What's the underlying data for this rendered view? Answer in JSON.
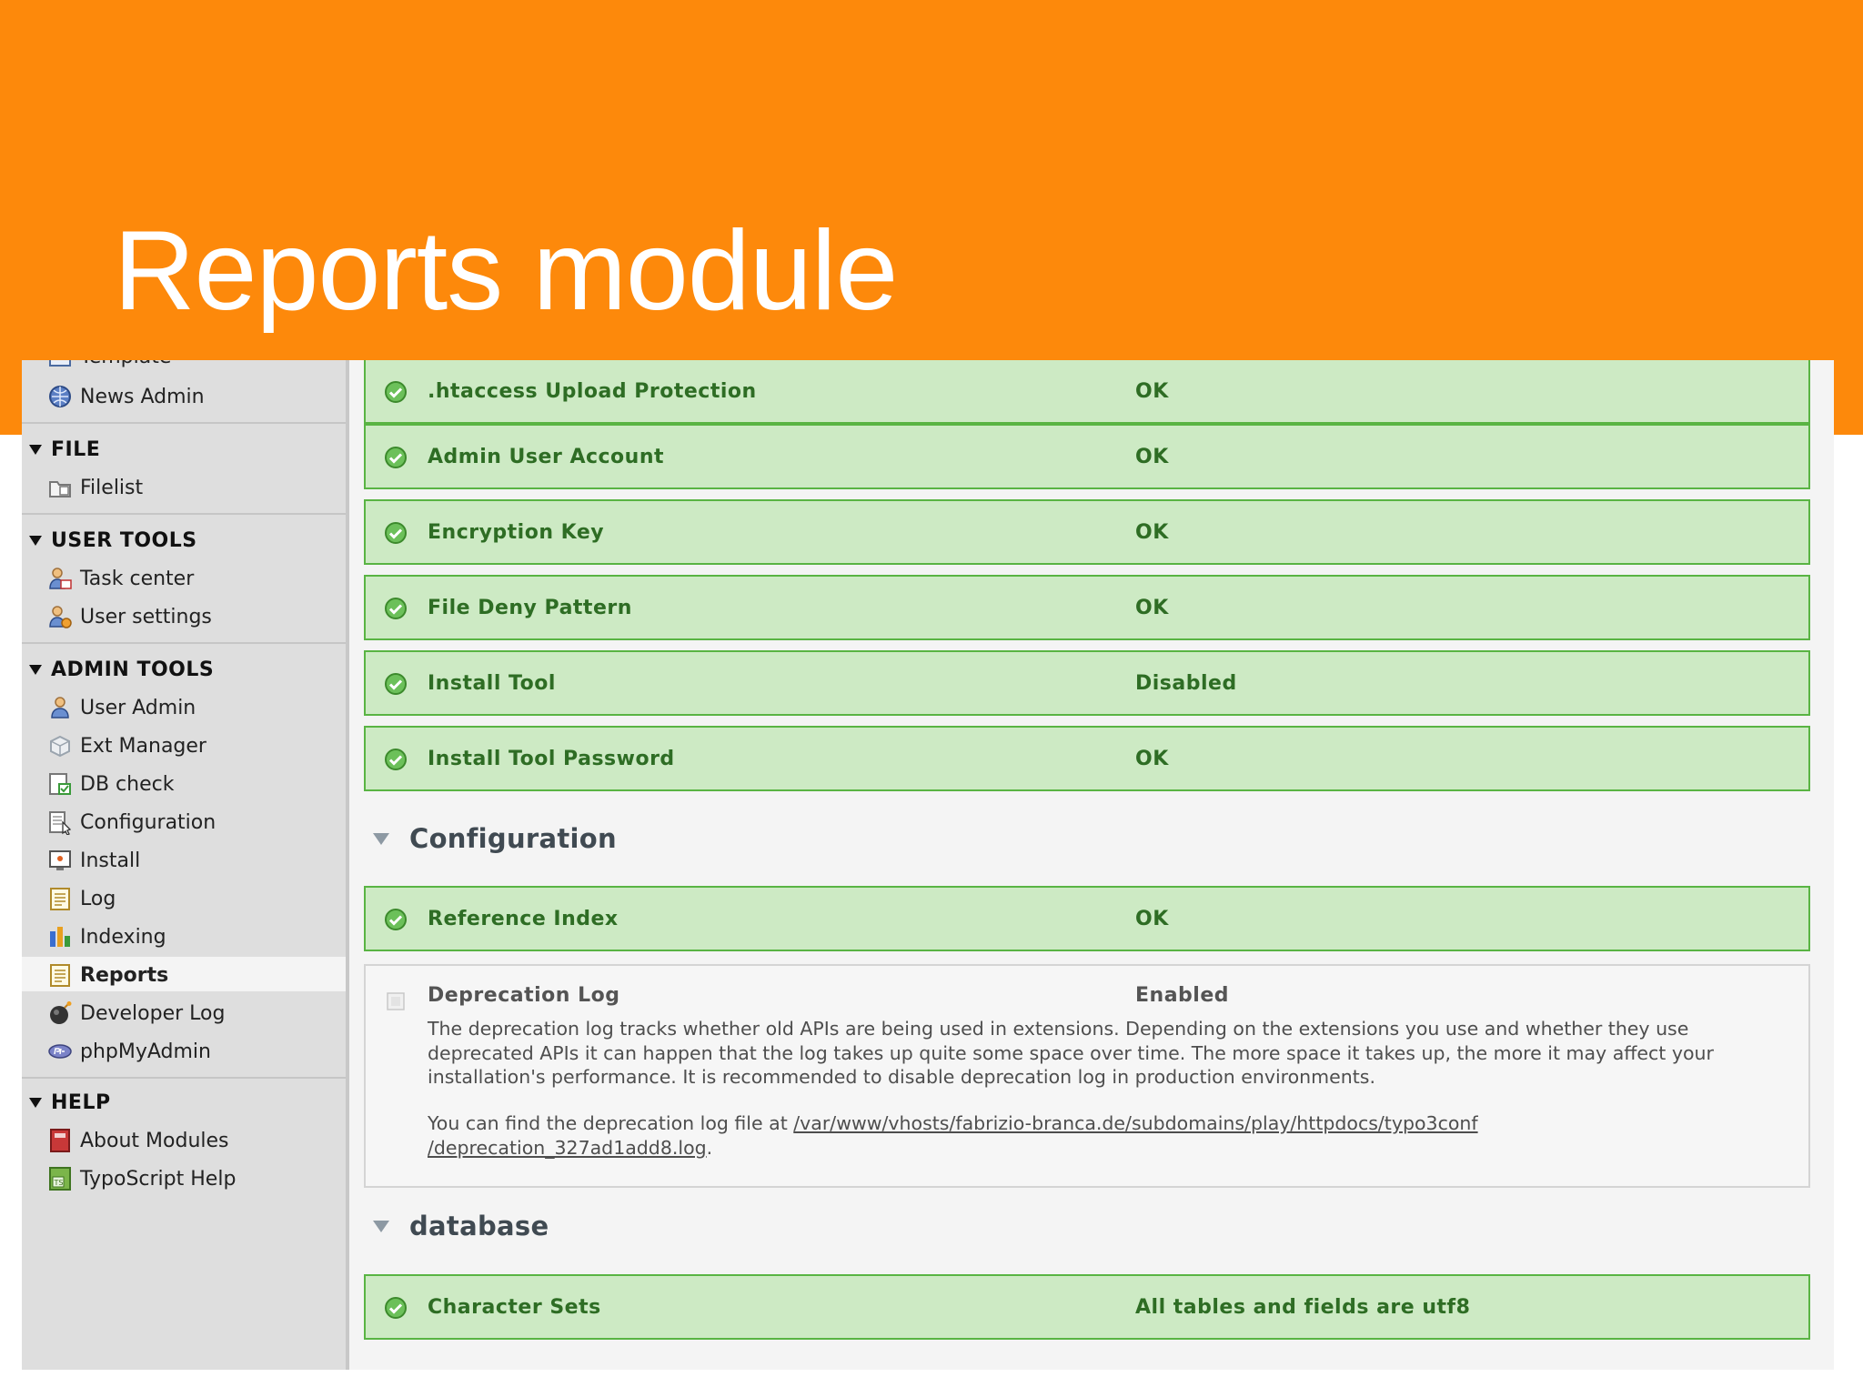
{
  "slide": {
    "title": "Reports module"
  },
  "sidebar": {
    "partial_item": "Template",
    "items_top": [
      {
        "label": "News Admin",
        "icon": "news-admin-icon"
      }
    ],
    "groups": [
      {
        "label": "FILE",
        "items": [
          {
            "label": "Filelist",
            "icon": "folder-list-icon"
          }
        ]
      },
      {
        "label": "USER TOOLS",
        "items": [
          {
            "label": "Task center",
            "icon": "user-task-icon"
          },
          {
            "label": "User settings",
            "icon": "user-settings-icon"
          }
        ]
      },
      {
        "label": "ADMIN TOOLS",
        "items": [
          {
            "label": "User Admin",
            "icon": "user-admin-icon"
          },
          {
            "label": "Ext Manager",
            "icon": "extension-icon"
          },
          {
            "label": "DB check",
            "icon": "db-check-icon"
          },
          {
            "label": "Configuration",
            "icon": "configuration-icon"
          },
          {
            "label": "Install",
            "icon": "install-icon"
          },
          {
            "label": "Log",
            "icon": "log-icon"
          },
          {
            "label": "Indexing",
            "icon": "bar-chart-icon"
          },
          {
            "label": "Reports",
            "icon": "reports-icon",
            "active": true
          },
          {
            "label": "Developer Log",
            "icon": "bomb-icon"
          },
          {
            "label": "phpMyAdmin",
            "icon": "php-icon"
          }
        ]
      },
      {
        "label": "HELP",
        "items": [
          {
            "label": "About Modules",
            "icon": "book-icon"
          },
          {
            "label": "TypoScript Help",
            "icon": "typoscript-icon"
          }
        ]
      }
    ]
  },
  "reports": {
    "security_rows": [
      {
        "name": ".htaccess Upload Protection",
        "value": "OK"
      },
      {
        "name": "Admin User Account",
        "value": "OK"
      },
      {
        "name": "Encryption Key",
        "value": "OK"
      },
      {
        "name": "File Deny Pattern",
        "value": "OK"
      },
      {
        "name": "Install Tool",
        "value": "Disabled"
      },
      {
        "name": "Install Tool Password",
        "value": "OK"
      }
    ],
    "configuration": {
      "title": "Configuration",
      "rows": [
        {
          "name": "Reference Index",
          "value": "OK"
        }
      ],
      "info": {
        "name": "Deprecation Log",
        "value": "Enabled",
        "description": "The deprecation log tracks whether old APIs are being used in extensions. Depending on the extensions you use and whether they use deprecated APIs it can happen that the log takes up quite some space over time. The more space it takes up, the more it may affect your installation's performance. It is recommended to disable deprecation log in production environments.",
        "file_prefix": "You can find the deprecation log file at ",
        "file_path_line1": "/var/www/vhosts/fabrizio-branca.de/subdomains/play/httpdocs/typo3conf",
        "file_path_line2": "/deprecation_327ad1add8.log",
        "file_suffix": "."
      }
    },
    "database": {
      "title": "database",
      "rows": [
        {
          "name": "Character Sets",
          "value": "All tables and fields are utf8"
        }
      ]
    }
  },
  "colors": {
    "banner": "#fd890b",
    "ok_background": "#cdeac4",
    "ok_border": "#59b443",
    "ok_text": "#2e6d24",
    "sidebar_background": "#dedede"
  }
}
